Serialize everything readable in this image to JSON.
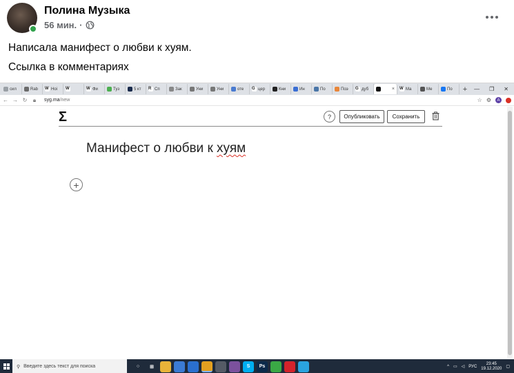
{
  "post": {
    "author": "Полина Музыка",
    "time": "56 мин.",
    "separator": "·",
    "text_line1": "Написала манифест о любви к хуям.",
    "text_line2": "Ссылка в комментариях"
  },
  "browser": {
    "tabs": [
      {
        "label": "сил",
        "color": "#9aa0a6"
      },
      {
        "label": "Rab",
        "color": "#6b6b6b"
      },
      {
        "label": "Hoi",
        "color": "#ffffff",
        "glyph": "W"
      },
      {
        "label": "",
        "color": "#ffffff",
        "glyph": "W"
      },
      {
        "label": "Фи",
        "color": "#ffffff",
        "glyph": "W"
      },
      {
        "label": "Туз",
        "color": "#4caf50"
      },
      {
        "label": "5 кт",
        "color": "#1a2b4c"
      },
      {
        "label": "Сп",
        "color": "#ffffff",
        "glyph": "R"
      },
      {
        "label": "Зак",
        "color": "#888888"
      },
      {
        "label": "Уни",
        "color": "#777777"
      },
      {
        "label": "Уни",
        "color": "#777777"
      },
      {
        "label": "оте",
        "color": "#4a7bd0"
      },
      {
        "label": "цер",
        "color": "#ffffff",
        "glyph": "G"
      },
      {
        "label": "Кни",
        "color": "#222222"
      },
      {
        "label": "Ин",
        "color": "#3b6fd4"
      },
      {
        "label": "По",
        "color": "#4a76a8"
      },
      {
        "label": "Поэ",
        "color": "#e8863a"
      },
      {
        "label": "дуб",
        "color": "#ffffff",
        "glyph": "G"
      },
      {
        "label": "",
        "color": "#111111",
        "active": true
      },
      {
        "label": "Ма",
        "color": "#ffffff",
        "glyph": "W"
      },
      {
        "label": "Ме",
        "color": "#555555"
      },
      {
        "label": "По",
        "color": "#1877f2"
      }
    ],
    "tab_close": "×",
    "new_tab": "+",
    "window_controls": [
      "—",
      "❐",
      "✕"
    ],
    "url_host": "syg.ma",
    "url_path": "/new",
    "profile_initial": "A"
  },
  "editor": {
    "logo": "Σ",
    "help": "?",
    "publish_label": "Опубликовать",
    "save_label": "Сохранить",
    "title_plain": "Манифест о любви к ",
    "title_misspelt": "хуям",
    "add_block": "+"
  },
  "taskbar": {
    "search_placeholder": "Введите здесь текст для поиска",
    "apps": [
      {
        "name": "task-view",
        "color": "#1f2b3b",
        "glyph": "○"
      },
      {
        "name": "widgets",
        "color": "#1f2b3b",
        "glyph": "⊞"
      },
      {
        "name": "explorer",
        "color": "#e8b339",
        "glyph": ""
      },
      {
        "name": "store",
        "color": "#3b7bd4",
        "glyph": ""
      },
      {
        "name": "mail",
        "color": "#2a6fcf",
        "glyph": ""
      },
      {
        "name": "chrome",
        "color": "#e3a020",
        "glyph": "",
        "active": true
      },
      {
        "name": "camera",
        "color": "#555b66",
        "glyph": ""
      },
      {
        "name": "viber",
        "color": "#7b519d",
        "glyph": ""
      },
      {
        "name": "skype",
        "color": "#00aff0",
        "glyph": "S"
      },
      {
        "name": "photoshop",
        "color": "#0b2a4a",
        "glyph": "Ps"
      },
      {
        "name": "utorrent",
        "color": "#3aa845",
        "glyph": ""
      },
      {
        "name": "acrobat",
        "color": "#d4232b",
        "glyph": ""
      },
      {
        "name": "telegram",
        "color": "#2aa3df",
        "glyph": ""
      }
    ],
    "lang": "РУС",
    "time": "23:45",
    "date": "19.12.2020"
  }
}
